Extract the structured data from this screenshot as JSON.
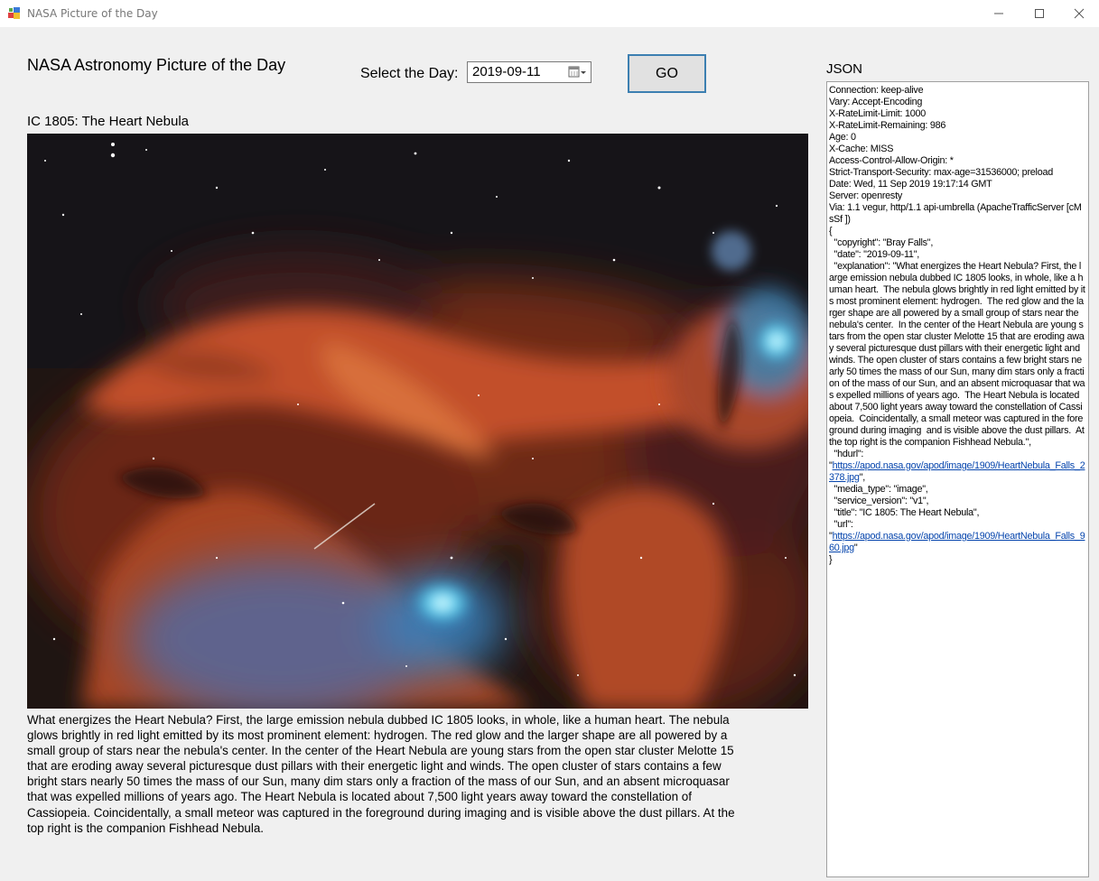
{
  "window": {
    "title": "NASA Picture of the Day"
  },
  "header": {
    "app_title": "NASA Astronomy Picture of the Day",
    "select_label": "Select the Day:",
    "date_value": "2019-09-11",
    "go_label": "GO"
  },
  "image": {
    "title": "IC 1805: The Heart Nebula",
    "explanation": "What energizes the Heart Nebula? First, the large emission nebula dubbed IC 1805 looks, in whole, like a human heart.  The nebula glows brightly in red light emitted by its most prominent element: hydrogen.  The red glow and the larger shape are all powered by a small group of stars near the nebula's center.  In the center of the Heart Nebula are young stars from the open star cluster Melotte 15 that are eroding away several picturesque dust pillars with their energetic light and winds. The open cluster of stars contains a few bright stars nearly 50 times the mass of our Sun, many dim stars only a fraction of the mass of our Sun, and an absent microquasar that was expelled millions of years ago.  The Heart Nebula is located about 7,500 light years away toward the constellation of Cassiopeia.  Coincidentally, a small meteor was captured in the foreground during imaging  and is visible above the dust pillars.  At the top right is the companion Fishhead Nebula."
  },
  "json_panel": {
    "label": "JSON",
    "headers": [
      "Connection: keep-alive",
      "Vary: Accept-Encoding",
      "X-RateLimit-Limit: 1000",
      "X-RateLimit-Remaining: 986",
      "Age: 0",
      "X-Cache: MISS",
      "Access-Control-Allow-Origin: *",
      "Strict-Transport-Security: max-age=31536000; preload",
      "Date: Wed, 11 Sep 2019 19:17:14 GMT",
      "Server: openresty",
      "Via: 1.1 vegur, http/1.1 api-umbrella (ApacheTrafficServer [cMsSf ])"
    ],
    "open_brace": "{",
    "copyright_line": "  \"copyright\": \"Bray Falls\",",
    "date_line": "  \"date\": \"2019-09-11\",",
    "explanation_line": "  \"explanation\": \"What energizes the Heart Nebula? First, the large emission nebula dubbed IC 1805 looks, in whole, like a human heart.  The nebula glows brightly in red light emitted by its most prominent element: hydrogen.  The red glow and the larger shape are all powered by a small group of stars near the nebula's center.  In the center of the Heart Nebula are young stars from the open star cluster Melotte 15 that are eroding away several picturesque dust pillars with their energetic light and winds. The open cluster of stars contains a few bright stars nearly 50 times the mass of our Sun, many dim stars only a fraction of the mass of our Sun, and an absent microquasar that was expelled millions of years ago.  The Heart Nebula is located about 7,500 light years away toward the constellation of Cassiopeia.  Coincidentally, a small meteor was captured in the foreground during imaging  and is visible above the dust pillars.  At the top right is the companion Fishhead Nebula.\",",
    "hdurl_key": "  \"hdurl\":",
    "hdurl_value": "https://apod.nasa.gov/apod/image/1909/HeartNebula_Falls_2378.jpg",
    "media_type_line": "  \"media_type\": \"image\",",
    "service_version_line": "  \"service_version\": \"v1\",",
    "title_line": "  \"title\": \"IC 1805: The Heart Nebula\",",
    "url_key": "  \"url\":",
    "url_value": "https://apod.nasa.gov/apod/image/1909/HeartNebula_Falls_960.jpg",
    "close_brace": "}",
    "quote": "\"",
    "quote_comma": "\",",
    "link_color": "#0645ad"
  }
}
